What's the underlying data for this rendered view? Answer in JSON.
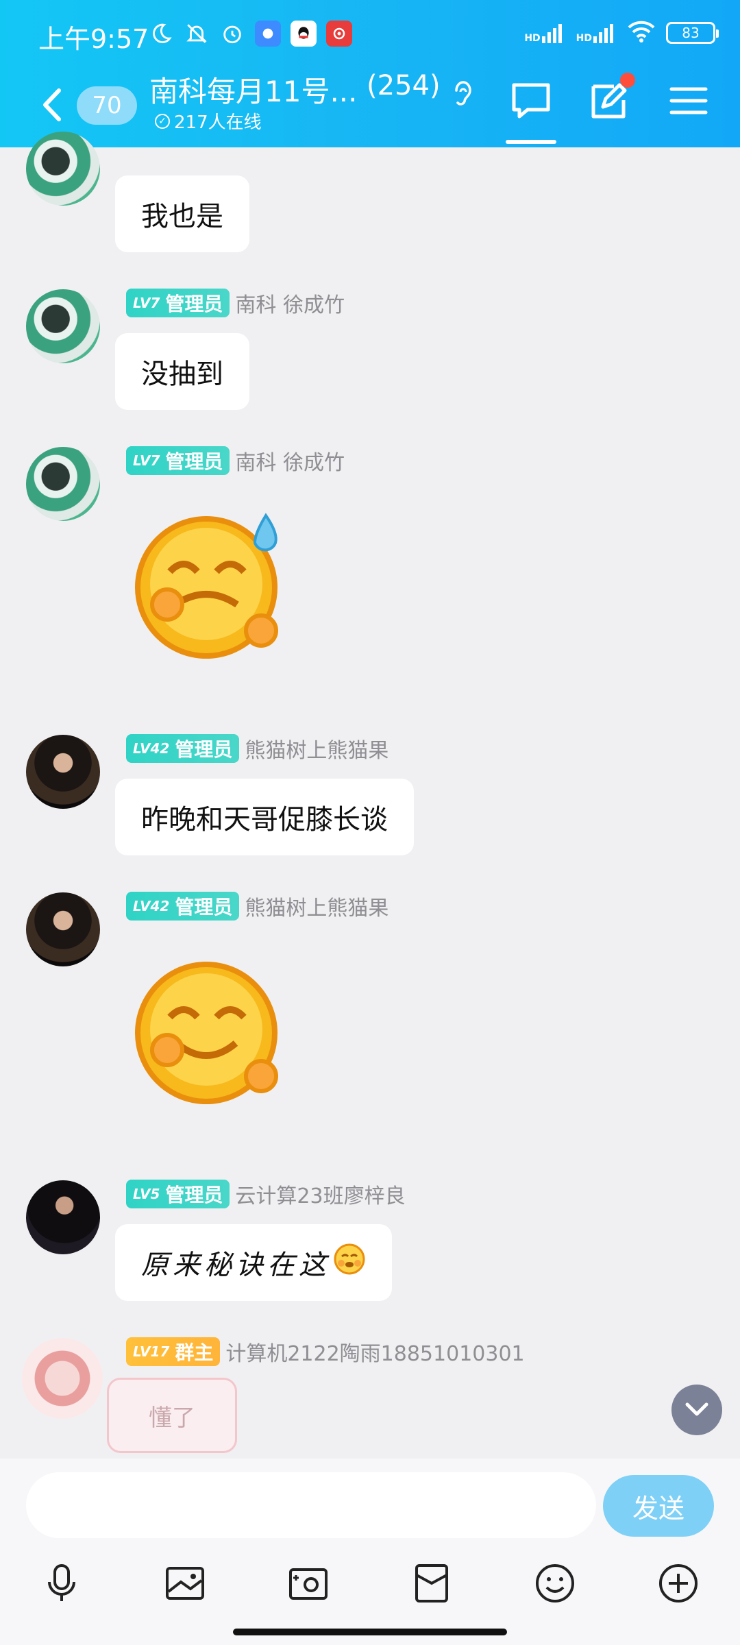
{
  "status_bar": {
    "time": "上午9:57",
    "battery": "83",
    "hd1": "HD",
    "hd2": "HD"
  },
  "header": {
    "back_badge": "70",
    "group_title": "南科每月11号...",
    "member_count": "(254)",
    "online_text": "217人在线"
  },
  "messages": [
    {
      "level": "LV7",
      "role": "管理员",
      "name": "南科 徐成竹",
      "text": "我也是"
    },
    {
      "level": "LV7",
      "role": "管理员",
      "name": "南科 徐成竹",
      "text": "没抽到"
    },
    {
      "level": "LV7",
      "role": "管理员",
      "name": "南科 徐成竹",
      "sticker": "sweat-smile-emoji"
    },
    {
      "level": "LV42",
      "role": "管理员",
      "name": "熊猫树上熊猫果",
      "text": "昨晚和天哥促膝长谈"
    },
    {
      "level": "LV42",
      "role": "管理员",
      "name": "熊猫树上熊猫果",
      "sticker": "smile-emoji"
    },
    {
      "level": "LV5",
      "role": "管理员",
      "name": "云计算23班廖梓良",
      "text": "原来秘诀在这"
    },
    {
      "level": "LV17",
      "role": "群主",
      "name": "计算机2122陶雨18851010301",
      "sticker_text": "懂了"
    }
  ],
  "input": {
    "placeholder": "",
    "send_label": "发送"
  },
  "colors": {
    "header": "#17b7f4",
    "admin_badge": "#2fd3c6",
    "owner_badge": "#ffc03a",
    "send_button": "#7fd0f6"
  },
  "toolbar_icons": [
    "microphone-icon",
    "image-icon",
    "camera-icon",
    "red-packet-icon",
    "emoji-icon",
    "plus-icon"
  ]
}
